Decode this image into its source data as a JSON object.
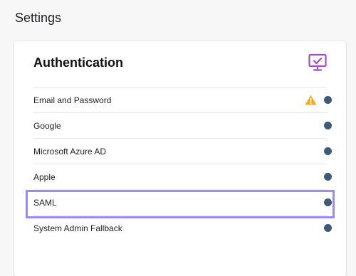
{
  "page": {
    "title": "Settings"
  },
  "auth": {
    "title": "Authentication",
    "icon": "monitor-check-icon",
    "accent": "#a14fc5",
    "dot_color": "#3e5a78",
    "warning_color": "#f5a623",
    "highlight_color": "#9d8af3",
    "items": [
      {
        "label": "Email and Password",
        "warning": true,
        "selected": false
      },
      {
        "label": "Google",
        "warning": false,
        "selected": false
      },
      {
        "label": "Microsoft Azure AD",
        "warning": false,
        "selected": false
      },
      {
        "label": "Apple",
        "warning": false,
        "selected": false
      },
      {
        "label": "SAML",
        "warning": false,
        "selected": true
      },
      {
        "label": "System Admin Fallback",
        "warning": false,
        "selected": false
      }
    ]
  }
}
